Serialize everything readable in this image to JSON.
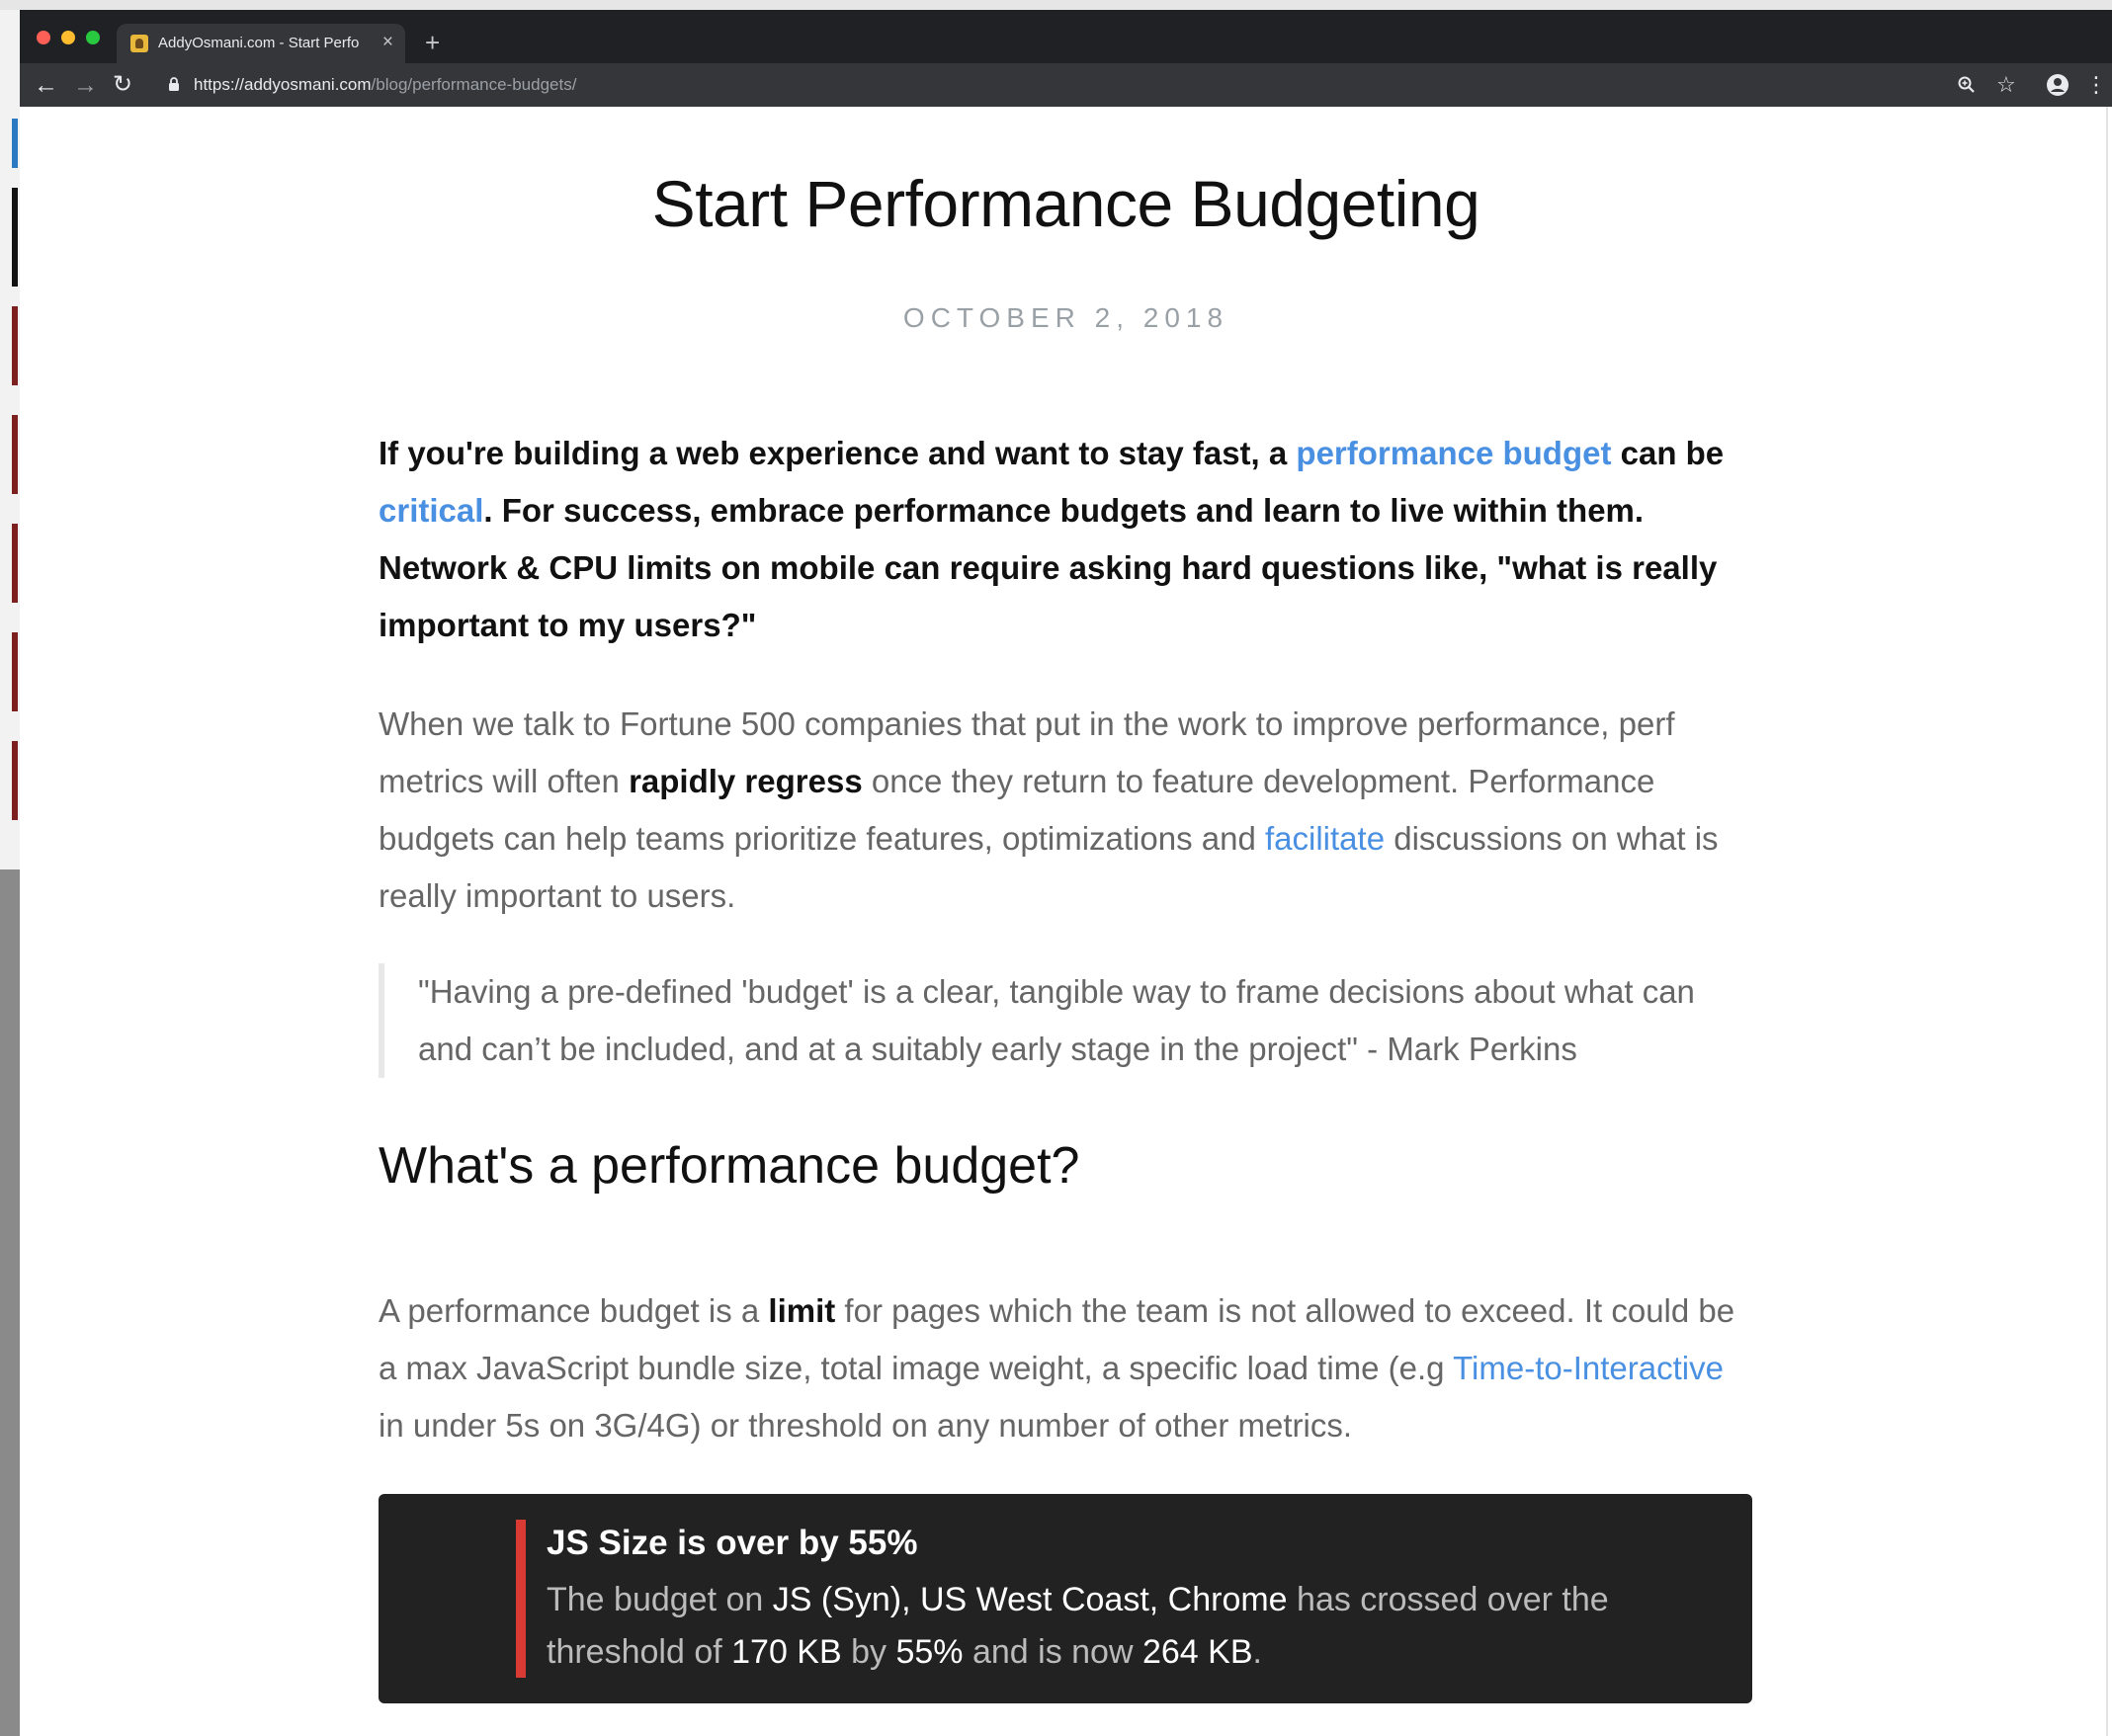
{
  "browser": {
    "tab_title": "AddyOsmani.com - Start Perfo",
    "tab_close": "×",
    "new_tab": "+",
    "url_host": "https://addyosmani.com",
    "url_path": "/blog/performance-budgets/",
    "icons": {
      "back": "arrow-left-icon",
      "forward": "arrow-right-icon",
      "reload": "reload-icon",
      "lock": "lock-icon",
      "zoom": "zoom-icon",
      "bookmark": "star-icon",
      "profile": "account-icon",
      "menu": "kebab-menu-icon"
    }
  },
  "article": {
    "title": "Start Performance Budgeting",
    "date": "OCTOBER 2, 2018",
    "lead": {
      "t1": "If you're building a web experience and want to stay fast, a ",
      "link1": "performance budget",
      "t2": " can be ",
      "link2": "critical",
      "t3": ". For success, embrace performance budgets and learn to live within them. Network & CPU limits on mobile can require asking hard questions like, \"what is really important to my users?\""
    },
    "para2": {
      "t1": "When we talk to Fortune 500 companies that put in the work to improve performance, perf metrics will often ",
      "bold": "rapidly regress",
      "t2": " once they return to feature development. Performance budgets can help teams prioritize features, optimizations and ",
      "link": "facilitate",
      "t3": " discussions on what is really important to users."
    },
    "quote": "\"Having a pre-defined 'budget' is a clear, tangible way to frame decisions about what can and can’t be included, and at a suitably early stage in the project\" - Mark Perkins",
    "heading2": "What's a performance budget?",
    "para3": {
      "t1": "A performance budget is a ",
      "bold": "limit",
      "t2": " for pages which the team is not allowed to exceed. It could be a max JavaScript bundle size, total image weight, a specific load time (e.g ",
      "link": "Time-to-Interactive",
      "t3": " in under 5s on 3G/4G) or threshold on any number of other metrics."
    },
    "alert": {
      "title": "JS Size is over by 55%",
      "b1": "The budget on ",
      "h1": "JS (Syn), US West Coast, Chrome",
      "b2": " has crossed over the threshold of ",
      "h2": "170 KB",
      "b3": " by ",
      "h3": "55%",
      "b4": " and is now ",
      "h4": "264 KB",
      "b5": "."
    }
  },
  "colors": {
    "link": "#4a90e2",
    "alert_accent": "#d93a34",
    "alert_bg": "#222222",
    "chrome_dark": "#202124"
  }
}
